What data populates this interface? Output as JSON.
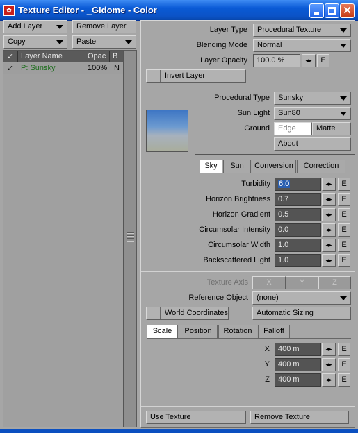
{
  "window": {
    "title": "Texture Editor - _GIdome - Color"
  },
  "left": {
    "add_layer": "Add Layer",
    "remove_layer": "Remove Layer",
    "copy": "Copy",
    "paste": "Paste",
    "columns": {
      "check": "✓",
      "name": "Layer Name",
      "opac": "Opac",
      "b": "B"
    },
    "rows": [
      {
        "check": "✓",
        "name": "P: Sunsky",
        "opac": "100%",
        "b": "N"
      }
    ]
  },
  "layer": {
    "type_label": "Layer Type",
    "type_value": "Procedural Texture",
    "blend_label": "Blending Mode",
    "blend_value": "Normal",
    "opacity_label": "Layer Opacity",
    "opacity_value": "100.0 %",
    "invert_label": "Invert Layer",
    "e": "E",
    "arrows": "◂▸"
  },
  "procedural": {
    "type_label": "Procedural Type",
    "type_value": "Sunsky",
    "sun_label": "Sun Light",
    "sun_value": "Sun80",
    "ground_label": "Ground",
    "ground_edge": "Edge",
    "ground_matte": "Matte",
    "about": "About"
  },
  "tabs1": [
    "Sky",
    "Sun",
    "Conversion",
    "Correction"
  ],
  "sky_params": [
    {
      "label": "Turbidity",
      "value": "6.0"
    },
    {
      "label": "Horizon Brightness",
      "value": "0.7"
    },
    {
      "label": "Horizon Gradient",
      "value": "0.5"
    },
    {
      "label": "Circumsolar Intensity",
      "value": "0.0"
    },
    {
      "label": "Circumsolar Width",
      "value": "1.0"
    },
    {
      "label": "Backscattered Light",
      "value": "1.0"
    }
  ],
  "axis": {
    "label": "Texture Axis",
    "x": "X",
    "y": "Y",
    "z": "Z"
  },
  "reference": {
    "label": "Reference Object",
    "value": "(none)"
  },
  "world_coords": "World Coordinates",
  "auto_sizing": "Automatic Sizing",
  "tabs2": [
    "Scale",
    "Position",
    "Rotation",
    "Falloff"
  ],
  "scale": [
    {
      "label": "X",
      "value": "400 m"
    },
    {
      "label": "Y",
      "value": "400 m"
    },
    {
      "label": "Z",
      "value": "400 m"
    }
  ],
  "footer": {
    "use": "Use Texture",
    "remove": "Remove Texture"
  }
}
